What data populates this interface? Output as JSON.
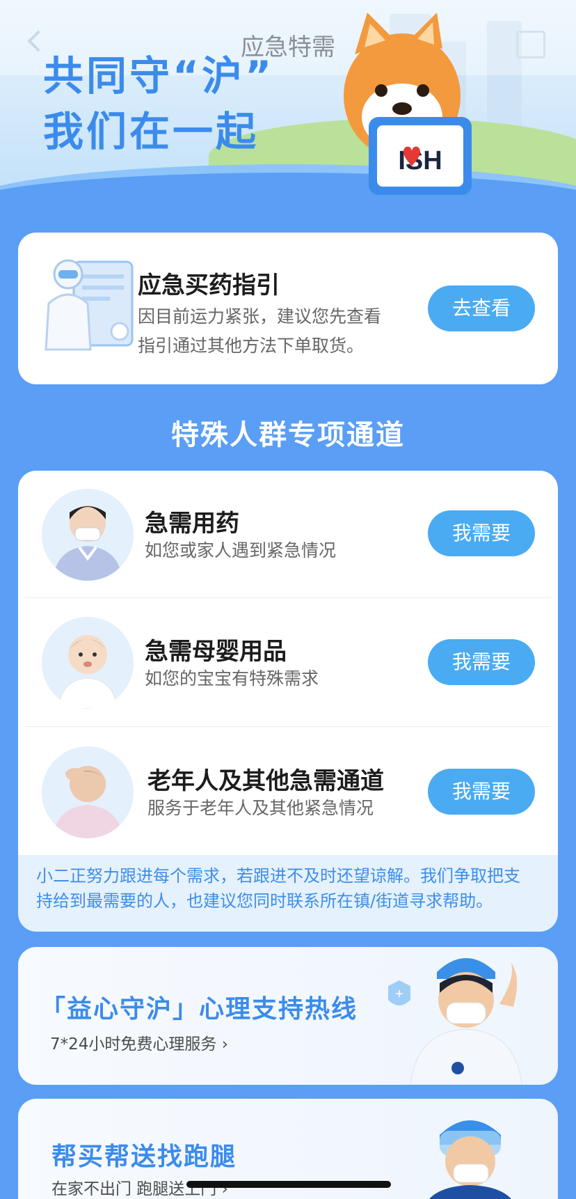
{
  "nav": {
    "title": "应急特需"
  },
  "hero": {
    "slogan_line1": "共同守“沪”",
    "slogan_line2": "我们在一起",
    "sign_text": "ISH"
  },
  "guide_card": {
    "title": "应急买药指引",
    "desc_line1": "因目前运力紧张，建议您先查看",
    "desc_line2": "指引通过其他方法下单取货。",
    "button": "去查看"
  },
  "special_section": {
    "title": "特殊人群专项通道",
    "items": [
      {
        "title": "急需用药",
        "desc": "如您或家人遇到紧急情况",
        "button": "我需要"
      },
      {
        "title": "急需母婴用品",
        "desc": "如您的宝宝有特殊需求",
        "button": "我需要"
      },
      {
        "title": "老年人及其他急需通道",
        "desc": "服务于老年人及其他紧急情况",
        "button": "我需要"
      }
    ],
    "note_line1": "小二正努力跟进每个需求，若跟进不及时还望谅解。我们争取把支",
    "note_line2": "持给到最需要的人，也建议您同时联系所在镇/街道寻求帮助。"
  },
  "hotline_card": {
    "title": "「益心守沪」心理支持热线",
    "subtitle": "7*24小时免费心理服务 ›"
  },
  "errand_card": {
    "title": "帮买帮送找跑腿",
    "subtitle": "在家不出门  跑腿送上门 ›"
  },
  "colors": {
    "background": "#5a9ef5",
    "accent": "#4aabf2",
    "title_blue": "#3b8bec"
  }
}
